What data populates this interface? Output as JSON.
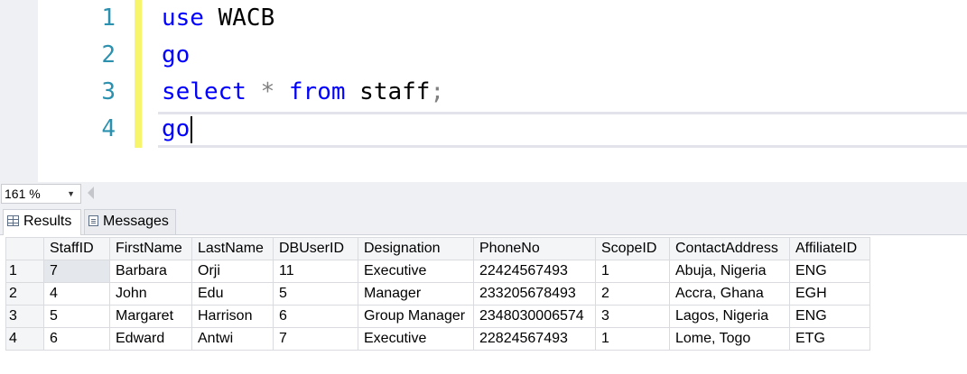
{
  "editor": {
    "line_numbers": [
      "1",
      "2",
      "3",
      "4"
    ],
    "lines": [
      {
        "kw1": "use",
        "text": " WACB"
      },
      {
        "kw1": "go"
      },
      {
        "kw1": "select",
        "op": " * ",
        "kw2": "from",
        "text": " staff",
        "semi": ";"
      },
      {
        "kw1": "go"
      }
    ]
  },
  "zoom": {
    "value": "161 %"
  },
  "tabs": {
    "results": "Results",
    "messages": "Messages"
  },
  "results": {
    "columns": [
      "StaffID",
      "FirstName",
      "LastName",
      "DBUserID",
      "Designation",
      "PhoneNo",
      "ScopeID",
      "ContactAddress",
      "AffiliateID"
    ],
    "rows": [
      {
        "num": "1",
        "cells": [
          "7",
          "Barbara",
          "Orji",
          "11",
          "Executive",
          "22424567493",
          "1",
          "Abuja, Nigeria",
          "ENG"
        ]
      },
      {
        "num": "2",
        "cells": [
          "4",
          "John",
          "Edu",
          "5",
          "Manager",
          "233205678493",
          "2",
          "Accra, Ghana",
          "EGH"
        ]
      },
      {
        "num": "3",
        "cells": [
          "5",
          "Margaret",
          "Harrison",
          "6",
          "Group Manager",
          "2348030006574",
          "3",
          "Lagos, Nigeria",
          "ENG"
        ]
      },
      {
        "num": "4",
        "cells": [
          "6",
          "Edward",
          "Antwi",
          "7",
          "Executive",
          "22824567493",
          "1",
          "Lome, Togo",
          "ETG"
        ]
      }
    ]
  },
  "colors": {
    "keyword": "#0000ff",
    "line_number": "#2b91af",
    "change_bar": "#f7f56b"
  }
}
